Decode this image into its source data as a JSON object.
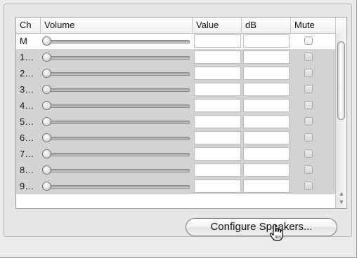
{
  "table": {
    "columns": [
      "Ch",
      "Volume",
      "Value",
      "dB",
      "Mute"
    ],
    "rows": [
      {
        "ch": "M",
        "level": 0,
        "value": "",
        "db": "",
        "muted": false,
        "enabled": true
      },
      {
        "ch": "1…",
        "level": 0,
        "value": "",
        "db": "",
        "muted": false,
        "enabled": false
      },
      {
        "ch": "2…",
        "level": 0,
        "value": "",
        "db": "",
        "muted": false,
        "enabled": false
      },
      {
        "ch": "3…",
        "level": 0,
        "value": "",
        "db": "",
        "muted": false,
        "enabled": false
      },
      {
        "ch": "4…",
        "level": 0,
        "value": "",
        "db": "",
        "muted": false,
        "enabled": false
      },
      {
        "ch": "5…",
        "level": 0,
        "value": "",
        "db": "",
        "muted": false,
        "enabled": false
      },
      {
        "ch": "6…",
        "level": 0,
        "value": "",
        "db": "",
        "muted": false,
        "enabled": false
      },
      {
        "ch": "7…",
        "level": 0,
        "value": "",
        "db": "",
        "muted": false,
        "enabled": false
      },
      {
        "ch": "8…",
        "level": 0,
        "value": "",
        "db": "",
        "muted": false,
        "enabled": false
      },
      {
        "ch": "9…",
        "level": 0,
        "value": "",
        "db": "",
        "muted": false,
        "enabled": false
      }
    ]
  },
  "actions": {
    "configure_speakers_label": "Configure Speakers..."
  },
  "icons": {
    "scroll_up": "scroll-up-arrow-icon",
    "scroll_down": "scroll-down-arrow-icon",
    "cursor": "hand-pointer-icon"
  },
  "colors": {
    "disabled_row": "#d3d3d3",
    "panel": "#e6e6e6"
  }
}
